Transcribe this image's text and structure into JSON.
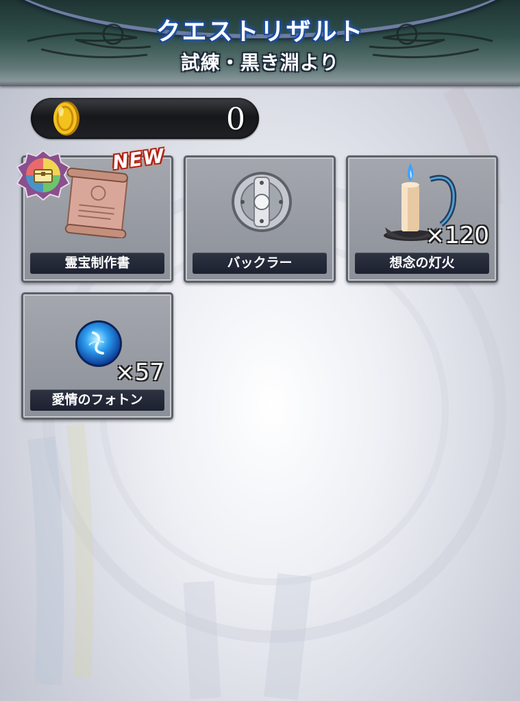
{
  "header": {
    "title": "クエストリザルト",
    "subtitle": "試練・黒き淵より"
  },
  "coins": {
    "value": "0",
    "icon": "gold-coin-icon"
  },
  "items": [
    {
      "name": "霊宝制作書",
      "quantity": "",
      "icon": "scroll-icon",
      "new_badge": "NEW",
      "rarity_badge": "rainbow-chest-icon"
    },
    {
      "name": "バックラー",
      "quantity": "",
      "icon": "buckler-shield-icon"
    },
    {
      "name": "想念の灯火",
      "quantity": "×120",
      "icon": "candle-icon"
    },
    {
      "name": "愛情のフォトン",
      "quantity": "×57",
      "icon": "blue-photon-orb-icon"
    }
  ],
  "colors": {
    "header_bg": "#31504b",
    "label_bg": "#1c2030",
    "card_bg": "#9a9ea6",
    "new_badge": "#b02215"
  }
}
